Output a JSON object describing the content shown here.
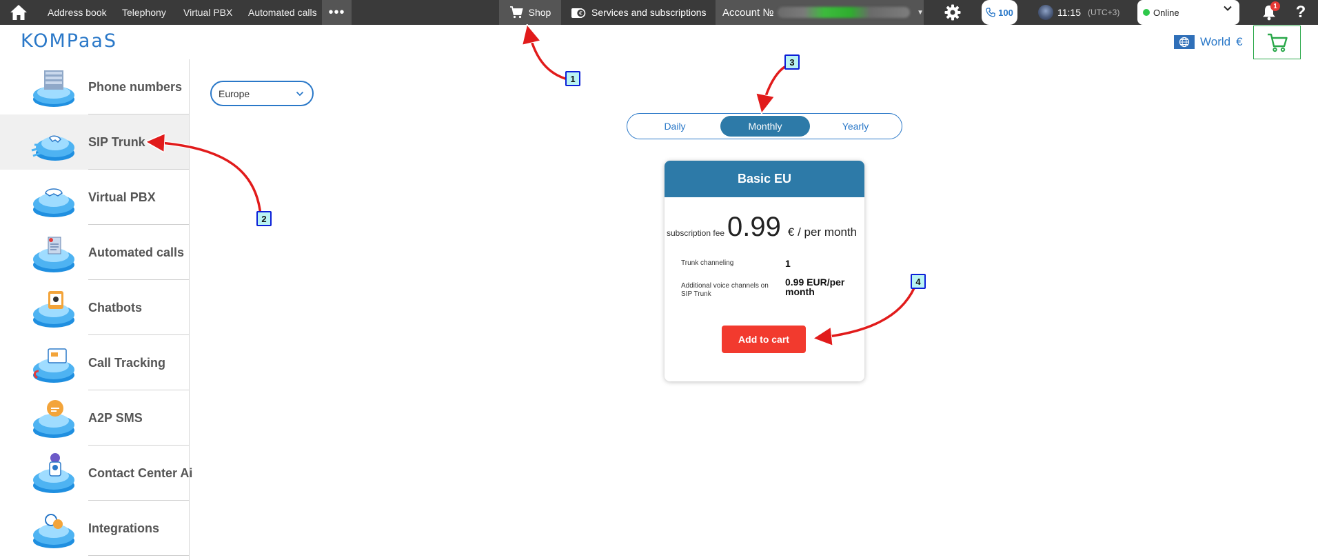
{
  "topbar": {
    "nav": [
      "Address book",
      "Telephony",
      "Virtual PBX",
      "Automated calls"
    ],
    "more": "•••",
    "shop": "Shop",
    "services": "Services and subscriptions",
    "account_label": "Account №",
    "calls_count": "100",
    "time": "11:15",
    "timezone": "(UTC+3)",
    "status": "Online",
    "notifications": "1",
    "help": "?"
  },
  "header": {
    "logo": "KOMPaaS",
    "region": "World",
    "currency": "€"
  },
  "sidebar": {
    "items": [
      {
        "label": "Phone numbers",
        "icon": "phone-numbers-icon"
      },
      {
        "label": "SIP Trunk",
        "icon": "sip-trunk-icon",
        "active": true
      },
      {
        "label": "Virtual PBX",
        "icon": "virtual-pbx-icon"
      },
      {
        "label": "Automated calls",
        "icon": "automated-calls-icon"
      },
      {
        "label": "Chatbots",
        "icon": "chatbots-icon"
      },
      {
        "label": "Call Tracking",
        "icon": "call-tracking-icon"
      },
      {
        "label": "A2P SMS",
        "icon": "a2p-sms-icon"
      },
      {
        "label": "Contact Center Ai",
        "icon": "contact-center-icon"
      },
      {
        "label": "Integrations",
        "icon": "integrations-icon"
      }
    ]
  },
  "main": {
    "region_select": "Europe",
    "periods": [
      {
        "label": "Daily",
        "selected": false
      },
      {
        "label": "Monthly",
        "selected": true
      },
      {
        "label": "Yearly",
        "selected": false
      }
    ],
    "plan": {
      "title": "Basic EU",
      "fee_label": "subscription fee",
      "fee_value": "0.99",
      "fee_unit": "€ / per month",
      "features": [
        {
          "label": "Trunk channeling",
          "value": "1"
        },
        {
          "label": "Additional voice channels on SIP Trunk",
          "value": "0.99 EUR/per month"
        }
      ],
      "add_to_cart": "Add to cart"
    }
  },
  "annotations": [
    "1",
    "2",
    "3",
    "4"
  ],
  "colors": {
    "topbar": "#3a3a3a",
    "brand": "#2a78c8",
    "card_header": "#2d7aa8",
    "cta": "#f23a2e",
    "arrow": "#e11b1b",
    "callout_fill": "#b9f3f3",
    "callout_border": "#0b1fd8"
  }
}
